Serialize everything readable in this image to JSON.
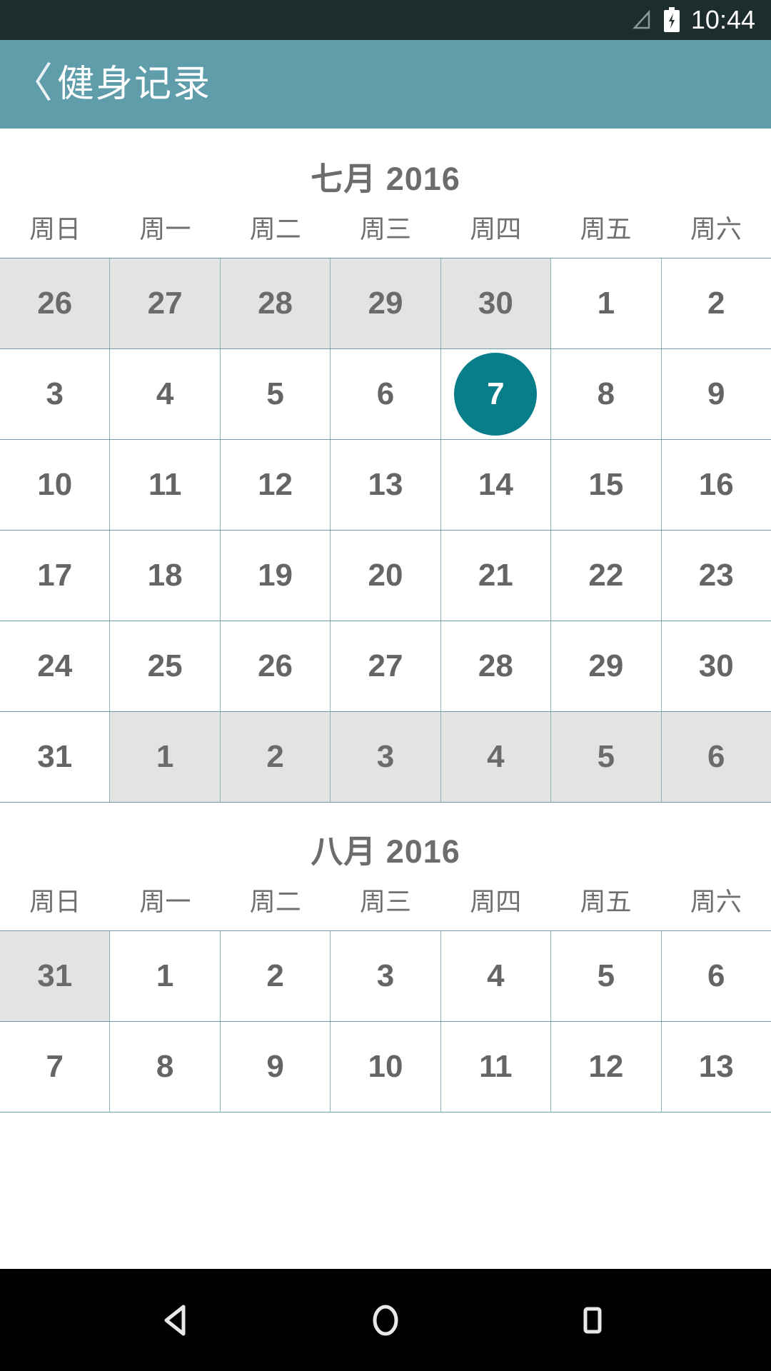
{
  "status_bar": {
    "time": "10:44",
    "icons": [
      "signal-icon",
      "battery-charging-icon"
    ],
    "background_color": "#1d2c2c"
  },
  "app_bar": {
    "back_label": "〈",
    "title": "健身记录",
    "background_color": "#5f9dab"
  },
  "theme": {
    "accent_color": "#077e89",
    "grid_line_color": "#6e9aa4",
    "other_month_bg": "#e3e3e3",
    "day_text_color": "#656565"
  },
  "weekdays": [
    "周日",
    "周一",
    "周二",
    "周三",
    "周四",
    "周五",
    "周六"
  ],
  "months": [
    {
      "title": "七月 2016",
      "weekdays": [
        "周日",
        "周一",
        "周二",
        "周三",
        "周四",
        "周五",
        "周六"
      ],
      "rows": [
        [
          {
            "day": "26",
            "other": true
          },
          {
            "day": "27",
            "other": true
          },
          {
            "day": "28",
            "other": true
          },
          {
            "day": "29",
            "other": true
          },
          {
            "day": "30",
            "other": true
          },
          {
            "day": "1",
            "other": false
          },
          {
            "day": "2",
            "other": false
          }
        ],
        [
          {
            "day": "3",
            "other": false
          },
          {
            "day": "4",
            "other": false
          },
          {
            "day": "5",
            "other": false
          },
          {
            "day": "6",
            "other": false
          },
          {
            "day": "7",
            "other": false,
            "selected": true
          },
          {
            "day": "8",
            "other": false
          },
          {
            "day": "9",
            "other": false
          }
        ],
        [
          {
            "day": "10",
            "other": false
          },
          {
            "day": "11",
            "other": false
          },
          {
            "day": "12",
            "other": false
          },
          {
            "day": "13",
            "other": false
          },
          {
            "day": "14",
            "other": false
          },
          {
            "day": "15",
            "other": false
          },
          {
            "day": "16",
            "other": false
          }
        ],
        [
          {
            "day": "17",
            "other": false
          },
          {
            "day": "18",
            "other": false
          },
          {
            "day": "19",
            "other": false
          },
          {
            "day": "20",
            "other": false
          },
          {
            "day": "21",
            "other": false
          },
          {
            "day": "22",
            "other": false
          },
          {
            "day": "23",
            "other": false
          }
        ],
        [
          {
            "day": "24",
            "other": false
          },
          {
            "day": "25",
            "other": false
          },
          {
            "day": "26",
            "other": false
          },
          {
            "day": "27",
            "other": false
          },
          {
            "day": "28",
            "other": false
          },
          {
            "day": "29",
            "other": false
          },
          {
            "day": "30",
            "other": false
          }
        ],
        [
          {
            "day": "31",
            "other": false
          },
          {
            "day": "1",
            "other": true
          },
          {
            "day": "2",
            "other": true
          },
          {
            "day": "3",
            "other": true
          },
          {
            "day": "4",
            "other": true
          },
          {
            "day": "5",
            "other": true
          },
          {
            "day": "6",
            "other": true
          }
        ]
      ]
    },
    {
      "title": "八月 2016",
      "weekdays": [
        "周日",
        "周一",
        "周二",
        "周三",
        "周四",
        "周五",
        "周六"
      ],
      "rows": [
        [
          {
            "day": "31",
            "other": true
          },
          {
            "day": "1",
            "other": false
          },
          {
            "day": "2",
            "other": false
          },
          {
            "day": "3",
            "other": false
          },
          {
            "day": "4",
            "other": false
          },
          {
            "day": "5",
            "other": false
          },
          {
            "day": "6",
            "other": false
          }
        ],
        [
          {
            "day": "7",
            "other": false
          },
          {
            "day": "8",
            "other": false
          },
          {
            "day": "9",
            "other": false
          },
          {
            "day": "10",
            "other": false
          },
          {
            "day": "11",
            "other": false
          },
          {
            "day": "12",
            "other": false
          },
          {
            "day": "13",
            "other": false
          }
        ]
      ]
    }
  ],
  "nav_bar": {
    "buttons": [
      "back-triangle-icon",
      "home-circle-icon",
      "recents-square-icon"
    ],
    "background_color": "#000000"
  }
}
